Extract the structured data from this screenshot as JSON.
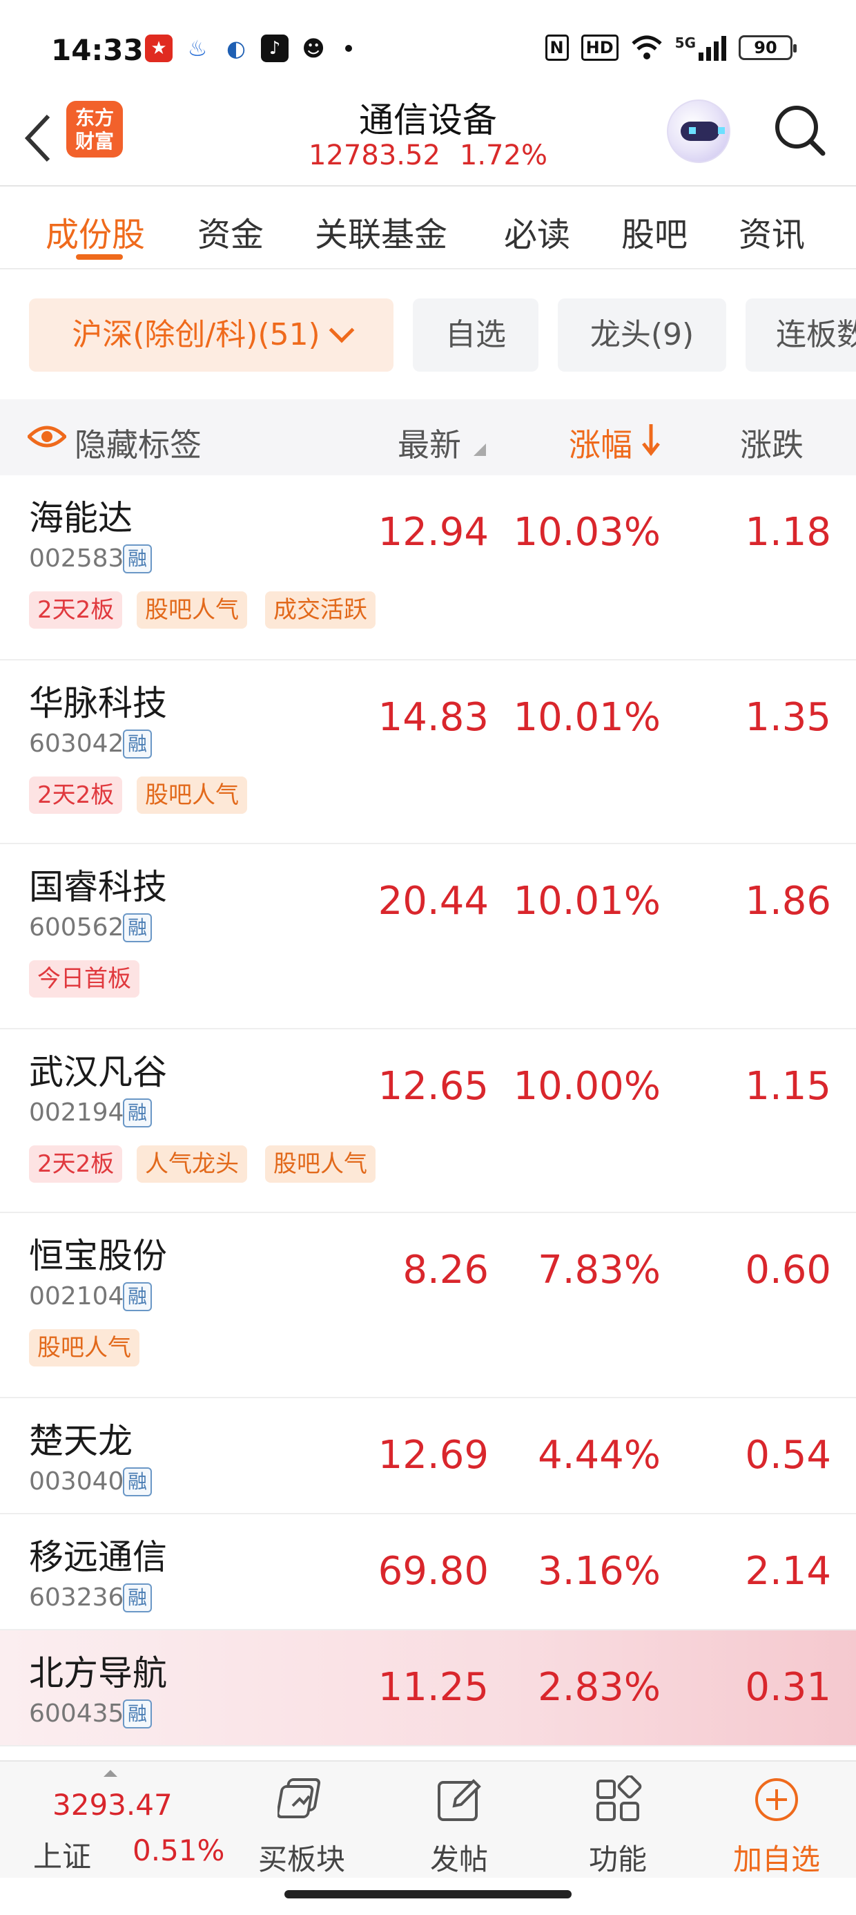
{
  "status_bar": {
    "time": "14:33",
    "icons_left": [
      "app-icon-red",
      "app-icon-blue",
      "app-icon-wave",
      "tiktok-icon",
      "qq-icon",
      "dot-icon"
    ],
    "icons_right": [
      "nfc-icon",
      "hd-icon",
      "wifi-icon",
      "5g-signal-icon",
      "battery-icon"
    ],
    "hd_label": "HD",
    "nfc_label": "N",
    "signal_label": "5G",
    "battery": "90"
  },
  "header": {
    "logo_text": "东方财富",
    "title": "通信设备",
    "index_value": "12783.52",
    "index_pct": "1.72%"
  },
  "tabs": [
    {
      "label": "成份股",
      "active": true
    },
    {
      "label": "资金",
      "active": false
    },
    {
      "label": "关联基金",
      "active": false
    },
    {
      "label": "必读",
      "active": false
    },
    {
      "label": "股吧",
      "active": false
    },
    {
      "label": "资讯",
      "active": false
    }
  ],
  "filters": [
    {
      "label": "沪深(除创/科)(51)",
      "active": true
    },
    {
      "label": "自选",
      "active": false
    },
    {
      "label": "龙头(9)",
      "active": false
    },
    {
      "label": "连板数",
      "active": false
    }
  ],
  "columns": {
    "hide_tags": "隐藏标签",
    "latest": "最新",
    "pct": "涨幅",
    "change": "涨跌"
  },
  "rows": [
    {
      "name": "海能达",
      "code": "002583",
      "badge": "融",
      "price": "12.94",
      "pct": "10.03%",
      "change": "1.18",
      "tags": [
        {
          "text": "2天2板",
          "style": "red"
        },
        {
          "text": "股吧人气",
          "style": "orange"
        },
        {
          "text": "成交活跃",
          "style": "orange"
        }
      ]
    },
    {
      "name": "华脉科技",
      "code": "603042",
      "badge": "融",
      "price": "14.83",
      "pct": "10.01%",
      "change": "1.35",
      "tags": [
        {
          "text": "2天2板",
          "style": "red"
        },
        {
          "text": "股吧人气",
          "style": "orange"
        }
      ]
    },
    {
      "name": "国睿科技",
      "code": "600562",
      "badge": "融",
      "price": "20.44",
      "pct": "10.01%",
      "change": "1.86",
      "tags": [
        {
          "text": "今日首板",
          "style": "red"
        }
      ]
    },
    {
      "name": "武汉凡谷",
      "code": "002194",
      "badge": "融",
      "price": "12.65",
      "pct": "10.00%",
      "change": "1.15",
      "tags": [
        {
          "text": "2天2板",
          "style": "red"
        },
        {
          "text": "人气龙头",
          "style": "orange"
        },
        {
          "text": "股吧人气",
          "style": "orange"
        }
      ]
    },
    {
      "name": "恒宝股份",
      "code": "002104",
      "badge": "融",
      "price": "8.26",
      "pct": "7.83%",
      "change": "0.60",
      "tags": [
        {
          "text": "股吧人气",
          "style": "orange"
        }
      ]
    },
    {
      "name": "楚天龙",
      "code": "003040",
      "badge": "融",
      "price": "12.69",
      "pct": "4.44%",
      "change": "0.54",
      "tags": []
    },
    {
      "name": "移远通信",
      "code": "603236",
      "badge": "融",
      "price": "69.80",
      "pct": "3.16%",
      "change": "2.14",
      "tags": []
    },
    {
      "name": "北方导航",
      "code": "600435",
      "badge": "融",
      "price": "11.25",
      "pct": "2.83%",
      "change": "0.31",
      "tags": [],
      "highlight": true
    }
  ],
  "bottom_bar": {
    "index_value": "3293.47",
    "index_name": "上证",
    "index_pct": "0.51%",
    "items": [
      {
        "label": "买板块",
        "icon": "buy-sector-icon"
      },
      {
        "label": "发帖",
        "icon": "post-icon"
      },
      {
        "label": "功能",
        "icon": "grid-icon"
      },
      {
        "label": "加自选",
        "icon": "plus-circle-icon"
      }
    ]
  },
  "colors": {
    "accent": "#ef6a1c",
    "rise": "#d9262c",
    "tag_red_bg": "#fde3e3",
    "tag_orange_bg": "#fde8d7"
  }
}
